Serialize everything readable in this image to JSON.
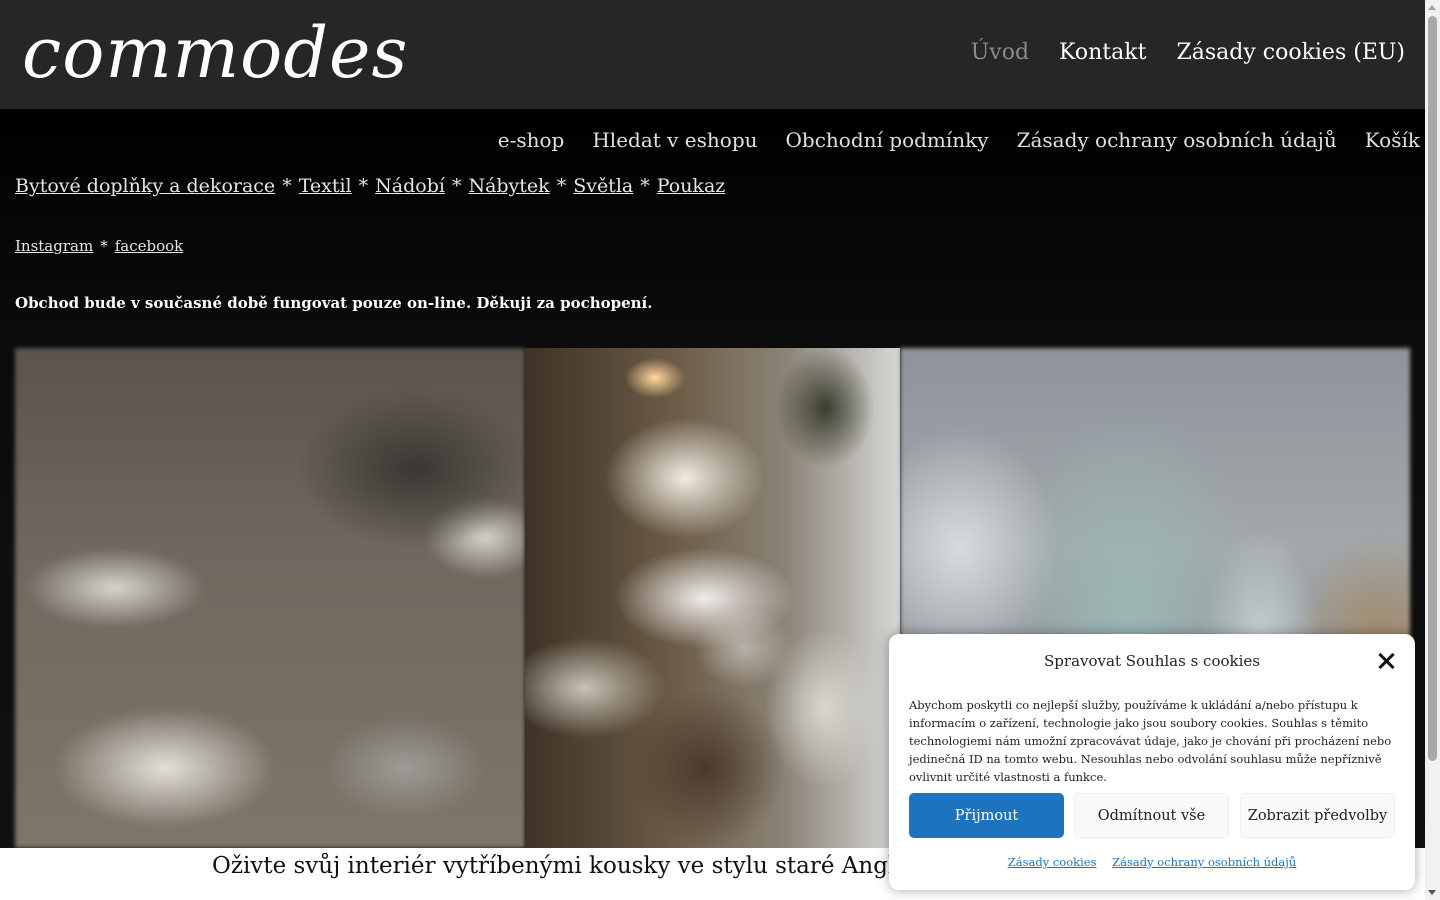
{
  "header": {
    "logo_text": "commodes",
    "nav": [
      {
        "label": "Úvod",
        "active": true
      },
      {
        "label": "Kontakt",
        "active": false
      },
      {
        "label": "Zásady cookies (EU)",
        "active": false
      }
    ]
  },
  "shop_nav": [
    "e-shop",
    "Hledat v eshopu",
    "Obchodní podmínky",
    "Zásady ochrany osobních údajů",
    "Košík"
  ],
  "categories": {
    "items": [
      "Bytové doplňky a dekorace",
      "Textil",
      "Nádobí",
      "Nábytek",
      "Světla",
      "Poukaz"
    ],
    "separator": "*"
  },
  "social": {
    "items": [
      "Instagram",
      "facebook"
    ],
    "separator": "*"
  },
  "notice": "Obchod bude v současné době fungovat pouze on-line. Děkuji za pochopení.",
  "tagline": "Oživte svůj interiér vytříbenými kousky ve stylu staré Anglie nebo",
  "cookie_banner": {
    "title": "Spravovat Souhlas s cookies",
    "body": "Abychom poskytli co nejlepší služby, používáme k ukládání a/nebo přístupu k informacím o zařízení, technologie jako jsou soubory cookies. Souhlas s těmito technologiemi nám umožní zpracovávat údaje, jako je chování při procházení nebo jedinečná ID na tomto webu. Nesouhlas nebo odvolání souhlasu může nepříznivě ovlivnit určité vlastnosti a funkce.",
    "accept_label": "Přijmout",
    "deny_label": "Odmítnout vše",
    "prefs_label": "Zobrazit předvolby",
    "link_cookies": "Zásady cookies",
    "link_privacy": "Zásady ochrany osobních údajů"
  },
  "colors": {
    "header_bg": "#262626",
    "accept_button": "#1e73be",
    "link_blue": "#1e73be"
  }
}
